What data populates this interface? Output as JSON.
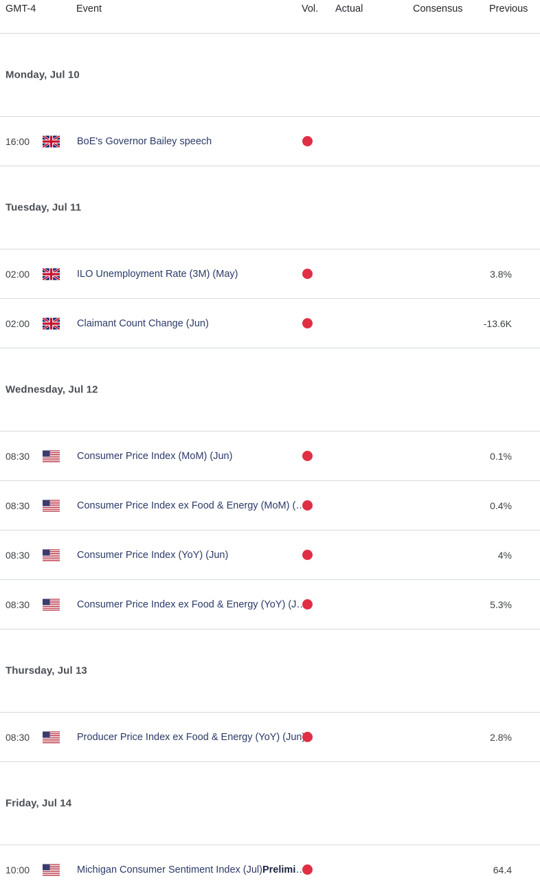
{
  "header": {
    "timezone_label": "GMT-4",
    "event_label": "Event",
    "vol_label": "Vol.",
    "actual_label": "Actual",
    "consensus_label": "Consensus",
    "previous_label": "Previous"
  },
  "theme": {
    "volatility_dot_color": "#e02f44",
    "event_link_color": "#2b3a67",
    "day_header_color": "#4a4e54",
    "divider_color": "#d6d9dc"
  },
  "days": [
    {
      "label": "Monday, Jul 10",
      "events": [
        {
          "time": "16:00",
          "flag": "uk-flag-icon",
          "title": "BoE's Governor Bailey speech",
          "title_emph": "",
          "volatility": "high",
          "actual": "",
          "consensus": "",
          "previous": ""
        }
      ]
    },
    {
      "label": "Tuesday, Jul 11",
      "events": [
        {
          "time": "02:00",
          "flag": "uk-flag-icon",
          "title": "ILO Unemployment Rate (3M) (May)",
          "title_emph": "",
          "volatility": "high",
          "actual": "",
          "consensus": "",
          "previous": "3.8%"
        },
        {
          "time": "02:00",
          "flag": "uk-flag-icon",
          "title": "Claimant Count Change (Jun)",
          "title_emph": "",
          "volatility": "high",
          "actual": "",
          "consensus": "",
          "previous": "-13.6K"
        }
      ]
    },
    {
      "label": "Wednesday, Jul 12",
      "events": [
        {
          "time": "08:30",
          "flag": "us-flag-icon",
          "title": "Consumer Price Index (MoM) (Jun)",
          "title_emph": "",
          "volatility": "high",
          "actual": "",
          "consensus": "",
          "previous": "0.1%"
        },
        {
          "time": "08:30",
          "flag": "us-flag-icon",
          "title": "Consumer Price Index ex Food & Energy (MoM) (Jun)",
          "title_emph": "",
          "volatility": "high",
          "actual": "",
          "consensus": "",
          "previous": "0.4%"
        },
        {
          "time": "08:30",
          "flag": "us-flag-icon",
          "title": "Consumer Price Index (YoY) (Jun)",
          "title_emph": "",
          "volatility": "high",
          "actual": "",
          "consensus": "",
          "previous": "4%"
        },
        {
          "time": "08:30",
          "flag": "us-flag-icon",
          "title": "Consumer Price Index ex Food & Energy (YoY) (Jun)",
          "title_emph": "",
          "volatility": "high",
          "actual": "",
          "consensus": "",
          "previous": "5.3%"
        }
      ]
    },
    {
      "label": "Thursday, Jul 13",
      "events": [
        {
          "time": "08:30",
          "flag": "us-flag-icon",
          "title": "Producer Price Index ex Food & Energy (YoY) (Jun)",
          "title_emph": "",
          "volatility": "high",
          "actual": "",
          "consensus": "",
          "previous": "2.8%"
        }
      ]
    },
    {
      "label": "Friday, Jul 14",
      "events": [
        {
          "time": "10:00",
          "flag": "us-flag-icon",
          "title": "Michigan Consumer Sentiment Index (Jul)",
          "title_emph": "Preliminary",
          "volatility": "high",
          "actual": "",
          "consensus": "",
          "previous": "64.4"
        }
      ]
    }
  ]
}
